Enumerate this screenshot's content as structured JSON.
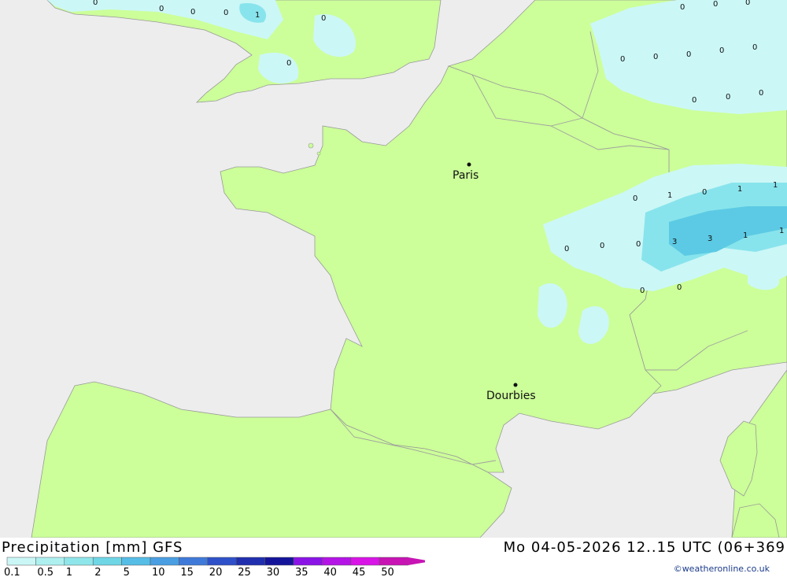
{
  "title": "Precipitation [mm] GFS",
  "date": "Mo 04-05-2026 12..15 UTC (06+369",
  "credit": "©weatheronline.co.uk",
  "colors": {
    "sea": "#ededed",
    "land": "#ccff99",
    "border": "#999999",
    "p01": "#ccf7f7",
    "p1": "#88e4ec",
    "p3": "#5ccae4"
  },
  "legend": {
    "labels": [
      "0.1",
      "0.5",
      "1",
      "2",
      "5",
      "10",
      "15",
      "20",
      "25",
      "30",
      "35",
      "40",
      "45",
      "50"
    ],
    "colors": [
      "#cbf6f6",
      "#aef0f0",
      "#8fe6ea",
      "#6fd6e6",
      "#55bde6",
      "#4a9ee2",
      "#3f7ad8",
      "#2e50c8",
      "#1f2fae",
      "#14149a",
      "#8a14e6",
      "#b414e6",
      "#d814e6",
      "#c814b4"
    ]
  },
  "cities": [
    {
      "name": "Paris"
    },
    {
      "name": "Dourbies"
    }
  ],
  "values": [
    "0",
    "0",
    "0",
    "0",
    "1",
    "0",
    "0",
    "0",
    "0",
    "0",
    "0",
    "0",
    "0",
    "0",
    "0",
    "0",
    "0",
    "0",
    "1",
    "0",
    "1",
    "1",
    "0",
    "0",
    "0",
    "3",
    "3",
    "1",
    "1",
    "0",
    "0",
    "0"
  ]
}
